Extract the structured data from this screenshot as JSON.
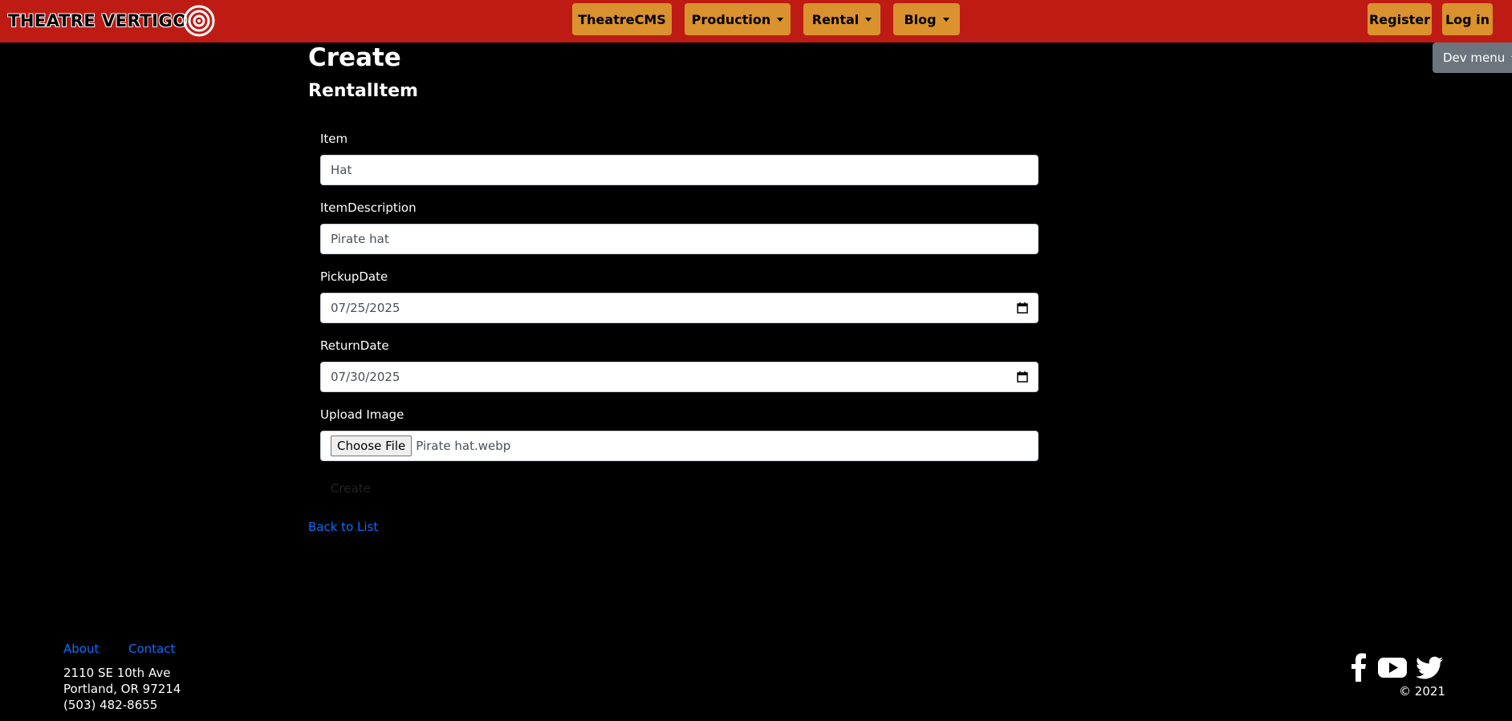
{
  "navbar": {
    "logo_text": "THEATRE VERTIGO",
    "items": [
      {
        "label": "TheatreCMS"
      },
      {
        "label": "Production"
      },
      {
        "label": "Rental"
      },
      {
        "label": "Blog"
      }
    ],
    "register_label": "Register",
    "login_label": "Log in",
    "dev_menu_label": "Dev menu"
  },
  "page": {
    "title": "Create",
    "subtitle": "RentalItem"
  },
  "form": {
    "item_label": "Item",
    "item_value": "Hat",
    "description_label": "ItemDescription",
    "description_value": "Pirate hat",
    "pickup_label": "PickupDate",
    "pickup_value": "07/25/2025",
    "return_label": "ReturnDate",
    "return_value": "07/30/2025",
    "upload_label": "Upload Image",
    "choose_file_label": "Choose File",
    "file_name": "Pirate hat.webp",
    "create_label": "Create"
  },
  "back_link": "Back to List",
  "footer": {
    "about": "About",
    "contact": "Contact",
    "address_line1": "2110 SE 10th Ave",
    "address_line2": "Portland, OR 97214",
    "phone": "(503) 482-8655",
    "copyright": "2021",
    "social_icons": [
      "facebook-icon",
      "youtube-icon",
      "twitter-icon"
    ]
  },
  "colors": {
    "navbar": "#bf1b15",
    "nav_button": "#d9922d",
    "link": "#0d6efd",
    "dev_menu": "#6c757d"
  }
}
